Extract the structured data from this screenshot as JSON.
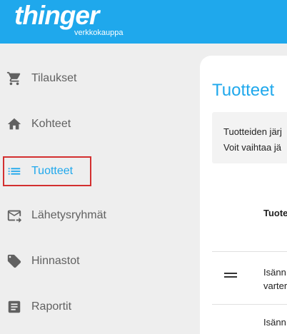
{
  "header": {
    "brand_name": "thinger",
    "brand_sub": "verkkokauppa",
    "bg_color": "#1fa8ec"
  },
  "sidebar": {
    "items": [
      {
        "label": "Tilaukset",
        "icon": "cart-icon",
        "active": false
      },
      {
        "label": "Kohteet",
        "icon": "home-icon",
        "active": false
      },
      {
        "label": "Tuotteet",
        "icon": "list-icon",
        "active": true
      },
      {
        "label": "Lähetysryhmät",
        "icon": "mail-forward-icon",
        "active": false
      },
      {
        "label": "Hinnastot",
        "icon": "tag-icon",
        "active": false
      },
      {
        "label": "Raportit",
        "icon": "report-icon",
        "active": false
      }
    ],
    "active_color": "#1fa8ec",
    "highlight_color": "#d32f2f"
  },
  "main": {
    "title": "Tuotteet",
    "info_lines": [
      "Tuotteiden järj",
      "Voit vaihtaa jä"
    ],
    "table": {
      "column_header": "Tuote",
      "rows": [
        {
          "text_line1": "Isänn",
          "text_line2": "varter"
        },
        {
          "text_line1": "Isänn"
        }
      ]
    }
  }
}
